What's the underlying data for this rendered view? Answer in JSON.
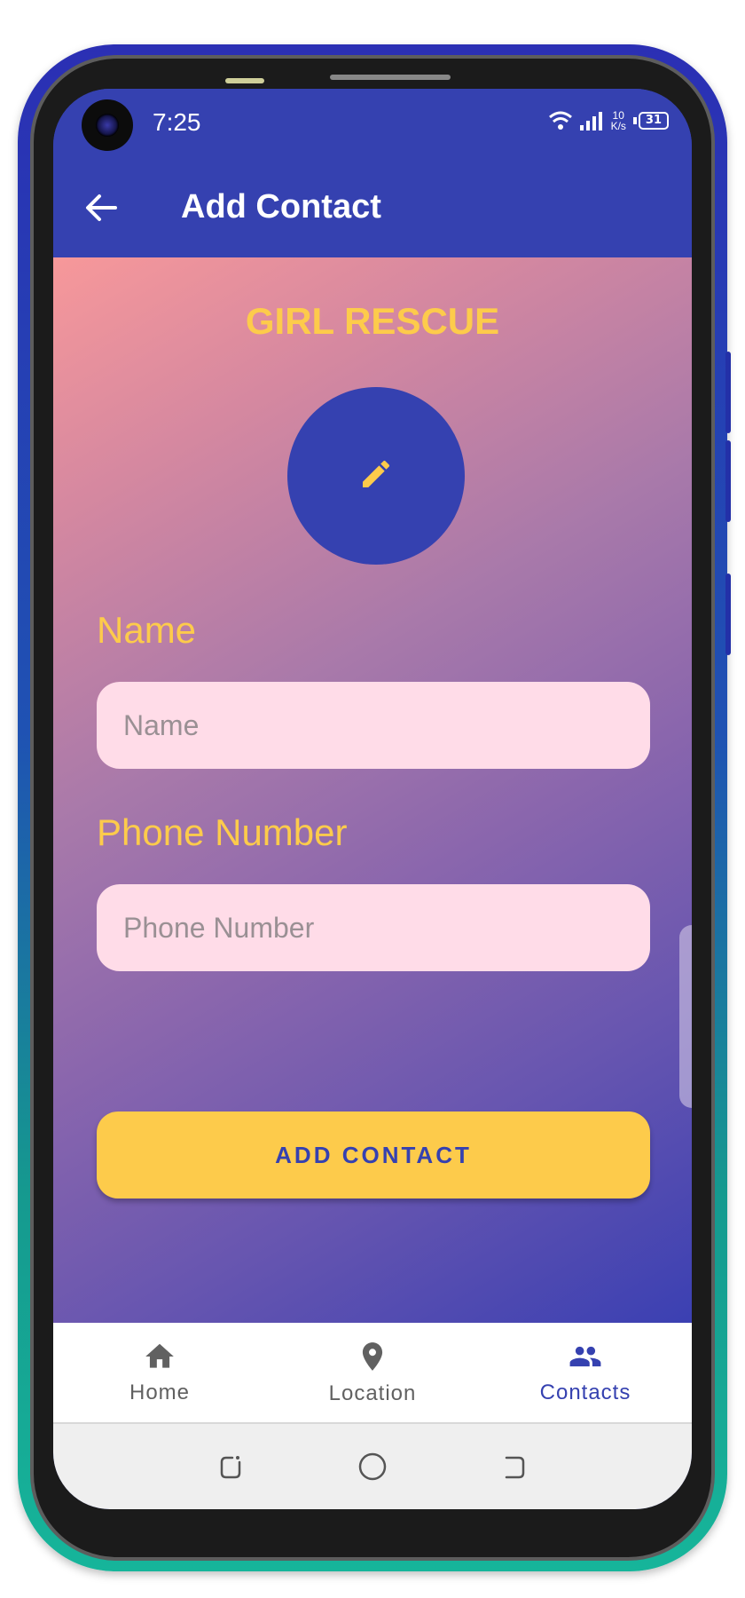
{
  "status_bar": {
    "time": "7:25",
    "net_speed_value": "10",
    "net_speed_unit": "K/s",
    "battery": "31"
  },
  "app_bar": {
    "title": "Add Contact",
    "back_icon": "arrow-left-icon"
  },
  "form": {
    "brand": "GIRL RESCUE",
    "avatar_icon": "pencil-icon",
    "name_label": "Name",
    "name_placeholder": "Name",
    "name_value": "",
    "phone_label": "Phone Number",
    "phone_placeholder": "Phone Number",
    "phone_value": "",
    "submit_label": "ADD CONTACT"
  },
  "bottom_nav": {
    "items": [
      {
        "label": "Home",
        "icon": "home-icon",
        "active": false
      },
      {
        "label": "Location",
        "icon": "location-pin-icon",
        "active": false
      },
      {
        "label": "Contacts",
        "icon": "people-icon",
        "active": true
      }
    ]
  },
  "system_nav": {
    "icons": [
      "recent-apps-icon",
      "home-circle-icon",
      "back-icon"
    ]
  },
  "colors": {
    "primary": "#3541b0",
    "accent": "#fdcb4b",
    "input_background": "#ffdce8",
    "gradient_start": "#f7989a",
    "gradient_end": "#3b40b2",
    "inactive_nav": "#616161"
  }
}
